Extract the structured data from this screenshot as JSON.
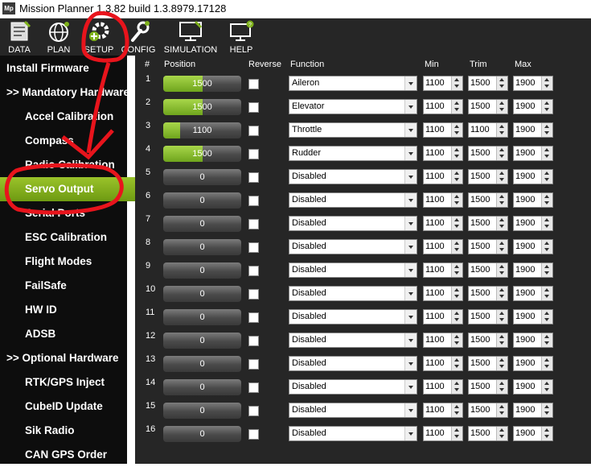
{
  "window": {
    "title": "Mission Planner 1.3.82 build 1.3.8979.17128",
    "icon_text": "Mp"
  },
  "toolbar": [
    {
      "label": "DATA",
      "icon": "data-icon"
    },
    {
      "label": "PLAN",
      "icon": "globe-icon"
    },
    {
      "label": "SETUP",
      "icon": "gear-plus-icon"
    },
    {
      "label": "CONFIG",
      "icon": "wrench-icon"
    },
    {
      "label": "SIMULATION",
      "icon": "monitor-icon"
    },
    {
      "label": "HELP",
      "icon": "help-monitor-icon"
    }
  ],
  "sidebar": [
    {
      "label": "Install Firmware",
      "level": "top"
    },
    {
      "label": ">> Mandatory Hardware",
      "level": "top"
    },
    {
      "label": "Accel Calibration",
      "level": "sub"
    },
    {
      "label": "Compass",
      "level": "sub"
    },
    {
      "label": "Radio Calibration",
      "level": "sub"
    },
    {
      "label": "Servo Output",
      "level": "sub",
      "active": true
    },
    {
      "label": "Serial Ports",
      "level": "sub"
    },
    {
      "label": "ESC Calibration",
      "level": "sub"
    },
    {
      "label": "Flight Modes",
      "level": "sub"
    },
    {
      "label": "FailSafe",
      "level": "sub"
    },
    {
      "label": "HW ID",
      "level": "sub"
    },
    {
      "label": "ADSB",
      "level": "sub"
    },
    {
      "label": ">> Optional Hardware",
      "level": "top"
    },
    {
      "label": "RTK/GPS Inject",
      "level": "sub"
    },
    {
      "label": "CubeID Update",
      "level": "sub"
    },
    {
      "label": "Sik Radio",
      "level": "sub"
    },
    {
      "label": "CAN GPS Order",
      "level": "sub"
    }
  ],
  "headers": {
    "num": "#",
    "position": "Position",
    "reverse": "Reverse",
    "function": "Function",
    "min": "Min",
    "trim": "Trim",
    "max": "Max"
  },
  "servos": [
    {
      "num": "1",
      "position": "1500",
      "level": 0.5,
      "function": "Aileron",
      "min": "1100",
      "trim": "1500",
      "max": "1900"
    },
    {
      "num": "2",
      "position": "1500",
      "level": 0.5,
      "function": "Elevator",
      "min": "1100",
      "trim": "1500",
      "max": "1900"
    },
    {
      "num": "3",
      "position": "1100",
      "level": 0.22,
      "function": "Throttle",
      "min": "1100",
      "trim": "1100",
      "max": "1900"
    },
    {
      "num": "4",
      "position": "1500",
      "level": 0.5,
      "function": "Rudder",
      "min": "1100",
      "trim": "1500",
      "max": "1900"
    },
    {
      "num": "5",
      "position": "0",
      "level": 0,
      "function": "Disabled",
      "min": "1100",
      "trim": "1500",
      "max": "1900"
    },
    {
      "num": "6",
      "position": "0",
      "level": 0,
      "function": "Disabled",
      "min": "1100",
      "trim": "1500",
      "max": "1900"
    },
    {
      "num": "7",
      "position": "0",
      "level": 0,
      "function": "Disabled",
      "min": "1100",
      "trim": "1500",
      "max": "1900"
    },
    {
      "num": "8",
      "position": "0",
      "level": 0,
      "function": "Disabled",
      "min": "1100",
      "trim": "1500",
      "max": "1900"
    },
    {
      "num": "9",
      "position": "0",
      "level": 0,
      "function": "Disabled",
      "min": "1100",
      "trim": "1500",
      "max": "1900"
    },
    {
      "num": "10",
      "position": "0",
      "level": 0,
      "function": "Disabled",
      "min": "1100",
      "trim": "1500",
      "max": "1900"
    },
    {
      "num": "11",
      "position": "0",
      "level": 0,
      "function": "Disabled",
      "min": "1100",
      "trim": "1500",
      "max": "1900"
    },
    {
      "num": "12",
      "position": "0",
      "level": 0,
      "function": "Disabled",
      "min": "1100",
      "trim": "1500",
      "max": "1900"
    },
    {
      "num": "13",
      "position": "0",
      "level": 0,
      "function": "Disabled",
      "min": "1100",
      "trim": "1500",
      "max": "1900"
    },
    {
      "num": "14",
      "position": "0",
      "level": 0,
      "function": "Disabled",
      "min": "1100",
      "trim": "1500",
      "max": "1900"
    },
    {
      "num": "15",
      "position": "0",
      "level": 0,
      "function": "Disabled",
      "min": "1100",
      "trim": "1500",
      "max": "1900"
    },
    {
      "num": "16",
      "position": "0",
      "level": 0,
      "function": "Disabled",
      "min": "1100",
      "trim": "1500",
      "max": "1900"
    }
  ],
  "colors": {
    "accent": "#7fb21b",
    "annotation": "#e8141c",
    "toolbar_bg": "#262626",
    "sidebar_bg": "#0d0d0d"
  }
}
